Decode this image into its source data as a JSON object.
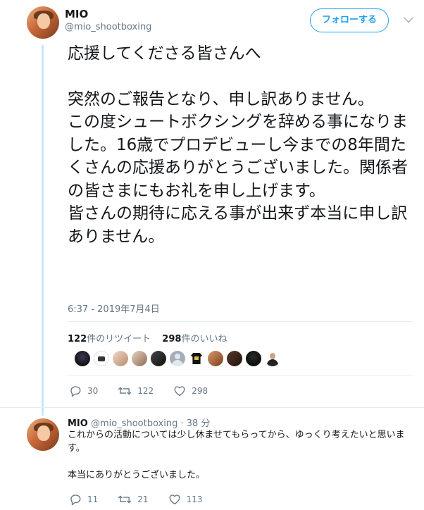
{
  "tweet": {
    "name": "MIO",
    "handle": "@mio_shootboxing",
    "follow_label": "フォローする",
    "text_lines": [
      "応援してくださる皆さんへ",
      "",
      "突然のご報告となり、申し訳ありません。",
      "この度シュートボクシングを辞める事になりました。16歳でプロデビューし今までの8年間たくさんの応援ありがとうございました。関係者の皆さまにもお礼を申し上げます。",
      "皆さんの期待に応える事が出来ず本当に申し訳ありません。"
    ],
    "timestamp": "6:37 - 2019年7月4日",
    "retweets_count": "122",
    "retweets_label": "件のリツイート",
    "likes_count": "298",
    "likes_label": "件のいいね",
    "actions": {
      "replies": "30",
      "retweets": "122",
      "likes": "298"
    }
  },
  "reply": {
    "name": "MIO",
    "handle": "@mio_shootboxing",
    "separator": "·",
    "time": "38 分",
    "text_lines": [
      "これからの活動については少し休ませてもらってから、ゆっくり考えたいと思います。",
      "",
      "本当にありがとうございました。"
    ],
    "actions": {
      "replies": "11",
      "retweets": "21",
      "likes": "113"
    }
  },
  "colors": {
    "accent": "#1da1f2",
    "thread_line": "#c4e7ff",
    "muted": "#657786"
  },
  "icons": {
    "reply": "reply-icon",
    "retweet": "retweet-icon",
    "like": "heart-icon",
    "menu": "chevron-down-icon"
  }
}
